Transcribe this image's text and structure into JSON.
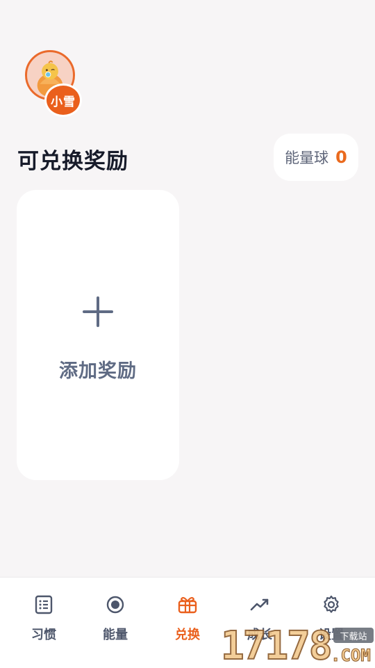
{
  "profile": {
    "name": "小雪",
    "avatar_icon": "baby-chick-avatar-icon"
  },
  "page": {
    "title": "可兑换奖励"
  },
  "energy": {
    "label": "能量球",
    "value": "0"
  },
  "add_card": {
    "label": "添加奖励",
    "icon": "plus-icon"
  },
  "tabs": [
    {
      "label": "习惯",
      "icon": "list-icon",
      "active": false
    },
    {
      "label": "能量",
      "icon": "target-icon",
      "active": false
    },
    {
      "label": "兑换",
      "icon": "gift-icon",
      "active": true
    },
    {
      "label": "成长",
      "icon": "trend-icon",
      "active": false
    },
    {
      "label": "设置",
      "icon": "gear-icon",
      "active": false
    }
  ],
  "watermark": {
    "digits": "17178",
    "site": "下载站",
    "domain": ".COM"
  },
  "colors": {
    "accent": "#ea5f1c",
    "text_dark": "#171b2a",
    "muted": "#5f6b84",
    "background": "#f7f5f6"
  }
}
